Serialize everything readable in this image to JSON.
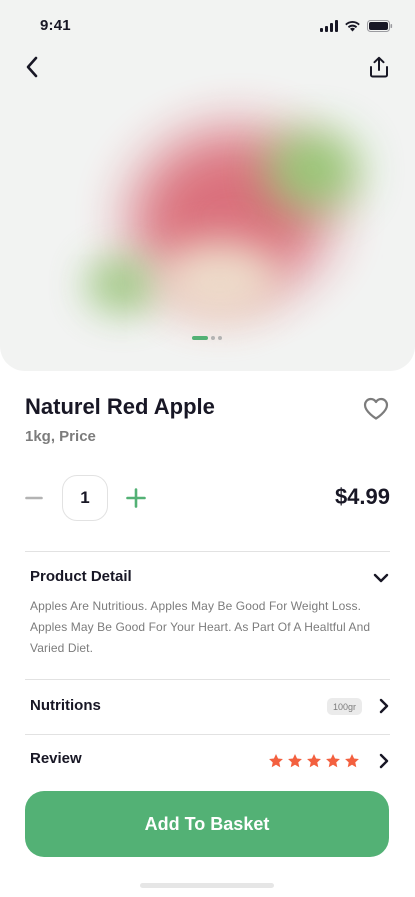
{
  "status_bar": {
    "time": "9:41"
  },
  "header": {
    "back_icon": "chevron-left-icon",
    "share_icon": "share-icon"
  },
  "gallery": {
    "image_count": 3,
    "active_index": 0
  },
  "product": {
    "name": "Naturel Red Apple",
    "subtitle": "1kg, Price",
    "quantity": "1",
    "price": "$4.99",
    "favorite": false
  },
  "sections": {
    "detail": {
      "title": "Product Detail",
      "text": "Apples Are Nutritious. Apples May Be Good For Weight Loss. Apples May Be Good For Your Heart. As Part Of A Healtful And Varied Diet."
    },
    "nutritions": {
      "title": "Nutritions",
      "badge": "100gr"
    },
    "review": {
      "title": "Review",
      "rating": 5,
      "max_rating": 5
    }
  },
  "actions": {
    "add_to_basket": "Add To Basket"
  },
  "colors": {
    "accent": "#53B175",
    "star": "#F3603F",
    "text_primary": "#181725",
    "text_secondary": "#7C7C7C",
    "hero_bg": "#F2F3F2"
  }
}
